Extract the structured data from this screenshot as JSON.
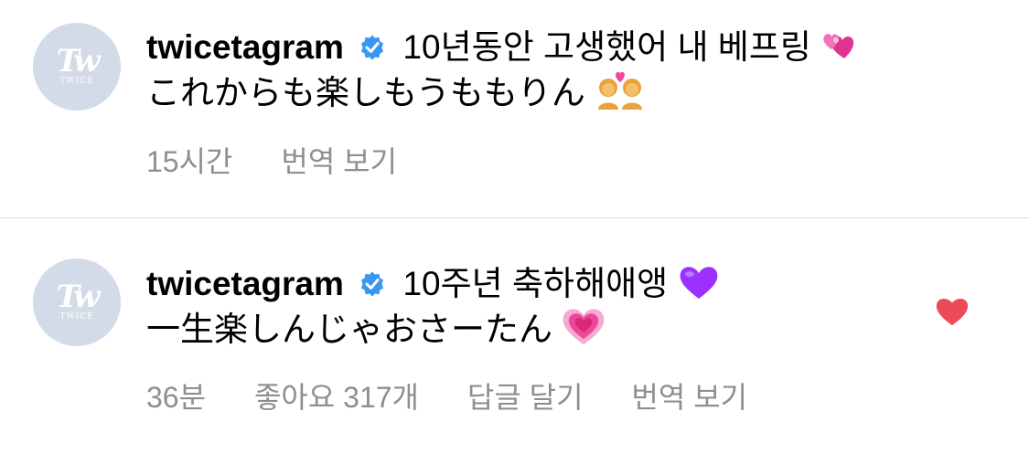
{
  "comments": [
    {
      "avatar_logo": "Tw",
      "avatar_text": "TWICE",
      "username": "twicetagram",
      "line1": "10년동안 고생했어 내 베프링",
      "line1_emoji": "two-hearts-emoji",
      "line2": "これからも楽しもうももりん",
      "line2_emoji": "couple-with-heart-emoji",
      "time": "15시간",
      "translate": "번역 보기",
      "liked": false
    },
    {
      "avatar_logo": "Tw",
      "avatar_text": "TWICE",
      "username": "twicetagram",
      "line1": "10주년 축하해애앵",
      "line1_emoji": "purple-heart-emoji",
      "line2": "一生楽しんじゃおさーたん",
      "line2_emoji": "growing-heart-emoji",
      "time": "36분",
      "likes": "좋아요 317개",
      "reply": "답글 달기",
      "translate": "번역 보기",
      "liked": true
    }
  ],
  "colors": {
    "verified_badge": "#3897f0",
    "meta_text": "#8e8e8e",
    "like_heart": "#ed4956",
    "avatar_bg": "#d3dbe8",
    "divider": "#dbdbdb"
  }
}
